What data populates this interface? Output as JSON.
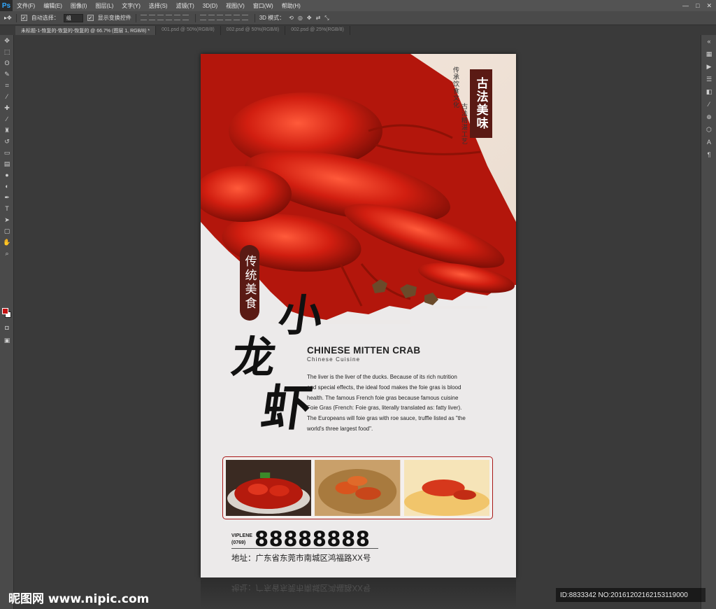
{
  "app": {
    "logo": "Ps",
    "menu": [
      "文件(F)",
      "编辑(E)",
      "图像(I)",
      "图层(L)",
      "文字(Y)",
      "选择(S)",
      "滤镜(T)",
      "3D(D)",
      "视图(V)",
      "窗口(W)",
      "帮助(H)"
    ],
    "window_controls": [
      "—",
      "□",
      "✕"
    ]
  },
  "options_bar": {
    "auto_select_label": "自动选择：",
    "auto_select_value": "组",
    "show_transform_label": "显示变换控件",
    "mode_3d_label": "3D 模式："
  },
  "tabs": [
    {
      "label": "未标题-1-恢复的-恢复的-恢复的 @ 66.7% (图层 1, RGB/8) *",
      "active": true
    },
    {
      "label": "001.psd @ 50%(RGB/8)",
      "active": false
    },
    {
      "label": "002.psd @ 50%(RGB/8)",
      "active": false
    },
    {
      "label": "002.psd @ 25%(RGB/8)",
      "active": false
    }
  ],
  "colors": {
    "foreground": "#c41111",
    "background": "#ffffff",
    "accent_dark_red": "#5a1a14",
    "gallery_border": "#a81717"
  },
  "poster": {
    "badge_right": "古法美味",
    "caption_right_1": "传承饮食文化",
    "caption_right_2": "古法精湛工艺",
    "badge_left": "传统美食",
    "title_chars": [
      "小",
      "龙",
      "虾"
    ],
    "en_title": "CHINESE MITTEN CRAB",
    "en_subtitle": "Chinese  Cuisine",
    "description_lines": [
      "The liver is the liver of the ducks. Because of its rich nutrition",
      "and special effects, the ideal food makes the foie gras is blood",
      "health. The famous French foie gras because famous cuisine",
      "Foie Gras (French: Foie gras, literally translated as: fatty liver).",
      "The Europeans will foie gras with roe sauce, truffle listed as \"the",
      "world's three largest food\"."
    ],
    "phone_prefix_top": "VIPLENE",
    "phone_prefix_bottom": "(0769)",
    "phone_number": "88888888",
    "address": "地址：广东省东莞市南城区鸿福路XX号"
  },
  "watermark": {
    "left": "昵图网 www.nipic.com",
    "right": "ID:8833342 NO:20161202162153119000"
  }
}
